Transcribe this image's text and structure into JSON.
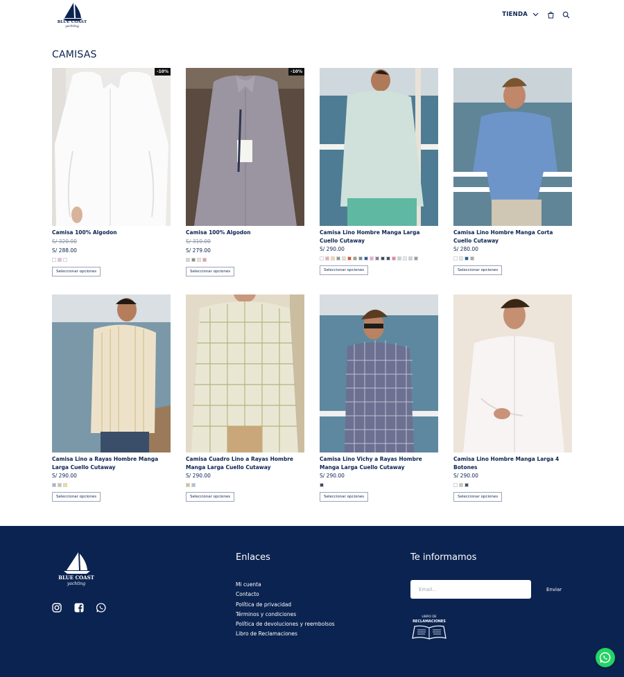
{
  "brand": {
    "name": "BLUE COAST",
    "tagline": "yachting"
  },
  "nav": {
    "shop_label": "TIENDA",
    "icons": [
      "chevron-down-icon",
      "cart-icon",
      "search-icon"
    ]
  },
  "page": {
    "title": "CAMISAS"
  },
  "products": [
    {
      "name": "Camisa 100% Algodon",
      "old_price": "S/ 320.00",
      "price": "S/ 288.00",
      "sale_badge": "-10%",
      "swatches": [
        "#ffffff",
        "#f2b6e0",
        "#ffffff"
      ],
      "button_label": "Seleccionar opciones"
    },
    {
      "name": "Camisa 100% Algodon",
      "old_price": "S/ 310.00",
      "price": "S/ 279.00",
      "sale_badge": "-10%",
      "swatches": [
        "#d5d5d5",
        "#8d8d8d",
        "#e5e3d6",
        "#ee9aa7"
      ],
      "button_label": "Seleccionar opciones"
    },
    {
      "name": "Camisa Lino Hombre Manga Larga Cuello Cutaway",
      "price": "S/ 290.00",
      "swatches": [
        "#ffffff",
        "#f0a8b5",
        "#eddc9a",
        "#8e9599",
        "#e7dfc8",
        "#e2502a",
        "#9e9d8c",
        "#6c89a0",
        "#2a5aa0",
        "#f4a3da",
        "#7c7f97",
        "#424659",
        "#3b5073",
        "#ee7f97",
        "#c6d0de",
        "#e3ecf4",
        "#c9d1d6",
        "#9c9f9c"
      ],
      "button_label": "Seleccionar opciones"
    },
    {
      "name": "Camisa Lino Hombre Manga Corta Cuello Cutaway",
      "price": "S/ 280.00",
      "swatches": [
        "#ffffff",
        "#e6e6e6",
        "#1f5ca0",
        "#a4a9ad"
      ],
      "button_label": "Seleccionar opciones"
    },
    {
      "name": "Camisa Lino a Rayas Hombre Manga Larga Cuello Cutaway",
      "price": "S/ 290.00",
      "swatches": [
        "#9db5d8",
        "#cfc295",
        "#f0df96"
      ],
      "button_label": "Seleccionar opciones"
    },
    {
      "name": "Camisa Cuadro Lino a Rayas Hombre Manga Larga Cuello Cutaway",
      "price": "S/ 290.00",
      "swatches": [
        "#d3c28f",
        "#a9c1e0"
      ],
      "button_label": "Seleccionar opciones"
    },
    {
      "name": "Camisa Lino Vichy a Rayas Hombre Manga Larga Cuello Cutaway",
      "price": "S/ 290.00",
      "swatches": [
        "#3e4668"
      ],
      "button_label": "Seleccionar opciones"
    },
    {
      "name": "Camisa Lino Hombre Manga Larga 4 Botones",
      "price": "S/ 290.00",
      "swatches": [
        "#ffffff",
        "#c6c6c1",
        "#435169"
      ],
      "button_label": "Seleccionar opciones"
    }
  ],
  "footer": {
    "links_heading": "Enlaces",
    "links": [
      "Mi cuenta",
      "Contacto",
      "Política de privacidad",
      "Términos y condiciones",
      "Política de devoluciones y reembolsos",
      "Libro de Reclamaciones"
    ],
    "news_heading": "Te informamos",
    "email_placeholder": "Email...",
    "send_label": "Enviar",
    "libro_line1": "LIBRO DE",
    "libro_line2": "RECLAMACIONES",
    "socials": [
      "instagram-icon",
      "facebook-icon",
      "whatsapp-icon"
    ],
    "colors": {
      "background": "#0b2350",
      "whatsapp": "#25d366"
    }
  }
}
